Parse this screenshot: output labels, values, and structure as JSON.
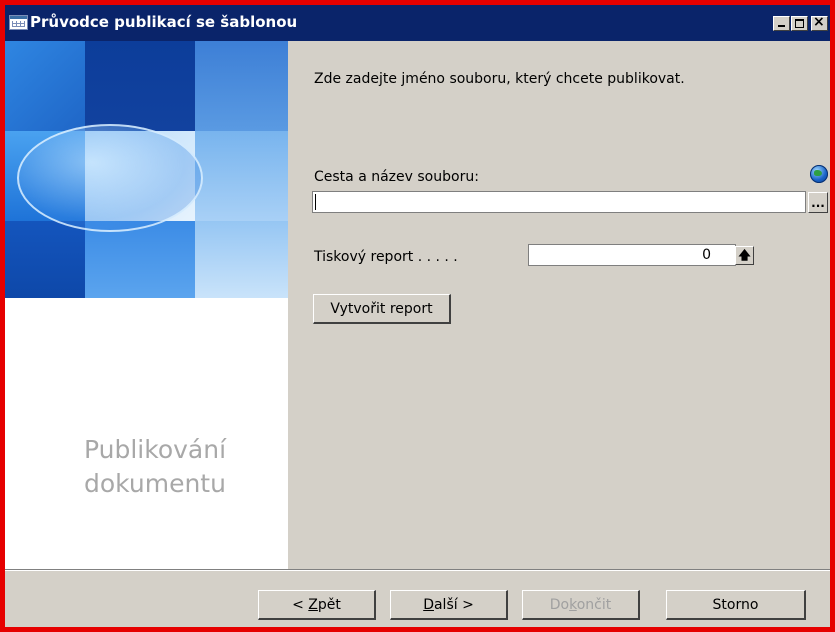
{
  "window": {
    "title": "Průvodce publikací se šablonou"
  },
  "sidebar": {
    "label_line1": "Publikování",
    "label_line2": "dokumentu"
  },
  "content": {
    "instruction": "Zde zadejte jméno souboru, který chcete publikovat.",
    "path_label": "Cesta a název souboru:",
    "path_value": "",
    "browse_label": "...",
    "report_label": "Tiskový report  . . . . .",
    "report_value": "0",
    "report_lookup_glyph": "🡅",
    "create_report_label": "Vytvořit report"
  },
  "footer": {
    "back_prefix": "< ",
    "back_key": "Z",
    "back_rest": "pět",
    "next_key": "D",
    "next_rest": "alší >",
    "finish_pre": "Do",
    "finish_key": "k",
    "finish_rest": "ončit",
    "cancel_label": "Storno"
  },
  "icons": {
    "app": "table-icon",
    "web": "globe-icon",
    "minimize": "minimize-icon",
    "maximize": "maximize-icon",
    "close": "close-icon"
  },
  "colors": {
    "title_bar": "#0a246a",
    "window_frame_highlight": "#e60000",
    "dialog_face": "#d4d0c8"
  }
}
